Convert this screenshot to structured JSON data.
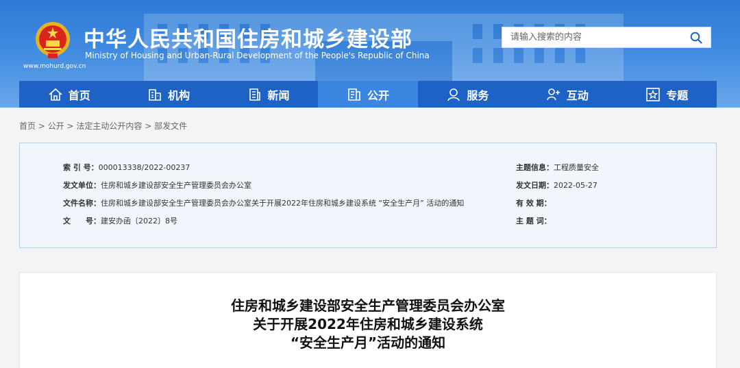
{
  "header": {
    "title": "中华人民共和国住房和城乡建设部",
    "subtitle": "Ministry of Housing and Urban-Rural Development of the People's Republic of China",
    "url": "www.mohurd.gov.cn",
    "search_placeholder": "请输入搜索的内容"
  },
  "nav": {
    "items": [
      {
        "label": "首页",
        "icon": "home-icon"
      },
      {
        "label": "机构",
        "icon": "building-icon"
      },
      {
        "label": "新闻",
        "icon": "news-icon"
      },
      {
        "label": "公开",
        "icon": "document-icon"
      },
      {
        "label": "服务",
        "icon": "service-icon"
      },
      {
        "label": "互动",
        "icon": "interaction-icon"
      },
      {
        "label": "专题",
        "icon": "star-icon"
      }
    ],
    "active": "公开"
  },
  "breadcrumb": [
    "首页",
    "公开",
    "法定主动公开内容",
    "部发文件"
  ],
  "meta": {
    "index_label": "索 引 号：",
    "index_value": "000013338/2022-00237",
    "issuer_label": "发文单位：",
    "issuer_value": "住房和城乡建设部安全生产管理委员会办公室",
    "docname_label": "文件名称：",
    "docname_value": "住房和城乡建设部安全生产管理委员会办公室关于开展2022年住房和城乡建设系统 “安全生产月” 活动的通知",
    "docno_label": "文　　号：",
    "docno_value": "建安办函〔2022〕8号",
    "topic_label": "主题信息：",
    "topic_value": "工程质量安全",
    "date_label": "发文日期：",
    "date_value": "2022-05-27",
    "validity_label": "有 效 期：",
    "validity_value": "",
    "keywords_label": "主 题 词：",
    "keywords_value": ""
  },
  "article": {
    "title_line1": "住房和城乡建设部安全生产管理委员会办公室",
    "title_line2": "关于开展2022年住房和城乡建设系统",
    "title_line3": "“安全生产月”活动的通知"
  }
}
